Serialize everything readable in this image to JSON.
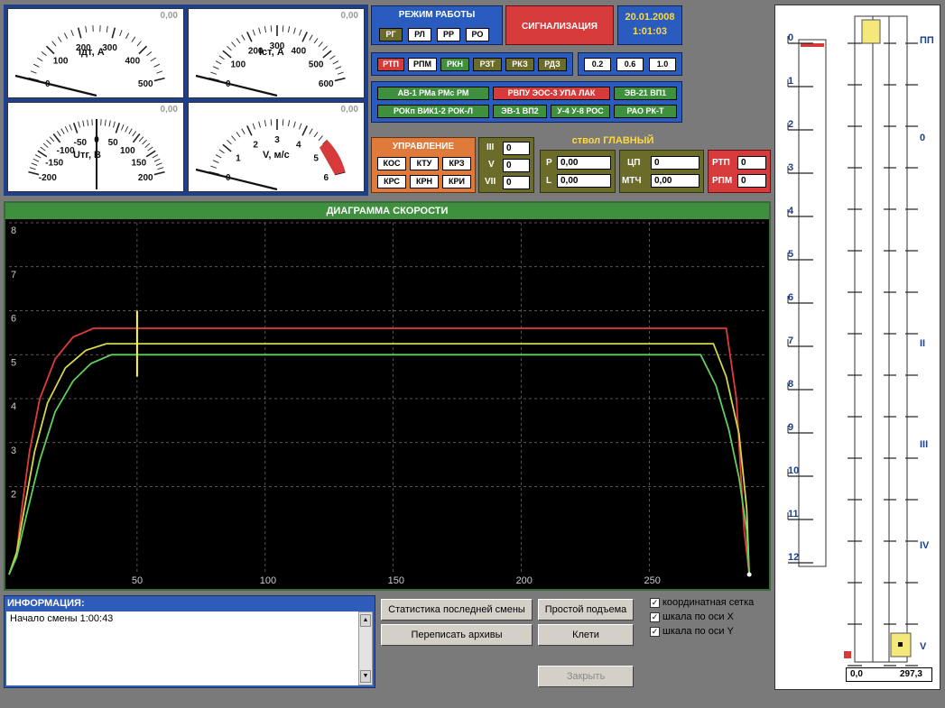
{
  "gauges": [
    {
      "id": "idt",
      "label": "Iдт, А",
      "value": "0,00",
      "ticks": [
        "0",
        "100",
        "200",
        "300",
        "400",
        "500"
      ]
    },
    {
      "id": "ist",
      "label": "Iст, А",
      "value": "0,00",
      "ticks": [
        "0",
        "100",
        "200",
        "300",
        "400",
        "500",
        "600"
      ]
    },
    {
      "id": "utg",
      "label": "Uтг, В",
      "value": "0,00",
      "ticks": [
        "-200",
        "-150",
        "-100",
        "-50",
        "0",
        "50",
        "100",
        "150",
        "200"
      ]
    },
    {
      "id": "v",
      "label": "V, м/с",
      "value": "0,00",
      "ticks": [
        "0",
        "1",
        "2",
        "3",
        "4",
        "5",
        "6"
      ]
    }
  ],
  "mode": {
    "title": "РЕЖИМ РАБОТЫ",
    "buttons": [
      "РГ",
      "РЛ",
      "РР",
      "РО"
    ]
  },
  "alarm": {
    "label": "СИГНАЛИЗАЦИЯ"
  },
  "datetime": {
    "date": "20.01.2008",
    "time": "1:01:03"
  },
  "relays": [
    "РТП",
    "РПМ",
    "РКН",
    "РЗТ",
    "РКЗ",
    "РДЗ"
  ],
  "steps": [
    "0.2",
    "0.6",
    "1.0"
  ],
  "protections": {
    "row1": [
      "АВ-1 РМа РМс РМ",
      "РВПУ ЭОС-3 УПА ЛАК",
      "ЭВ-21 ВП1"
    ],
    "row2": [
      "РОКп ВИК1-2 РОК-Л",
      "ЭВ-1 ВП2",
      "У-4 У-8 РОС",
      "РАО РК-Т"
    ]
  },
  "control": {
    "title": "УПРАВЛЕНИЕ",
    "row1": [
      "КОС",
      "КТУ",
      "КРЗ"
    ],
    "row2": [
      "КРС",
      "КРН",
      "КРИ"
    ]
  },
  "gears": [
    {
      "label": "III",
      "value": "0"
    },
    {
      "label": "V",
      "value": "0"
    },
    {
      "label": "VII",
      "value": "0"
    }
  ],
  "shaft_title": "ствол ГЛАВНЫЙ",
  "pl": [
    {
      "label": "P",
      "value": "0,00"
    },
    {
      "label": "L",
      "value": "0,00"
    }
  ],
  "cp": [
    {
      "label": "ЦП",
      "value": "0"
    },
    {
      "label": "МТЧ",
      "value": "0,00"
    }
  ],
  "rtp": [
    {
      "label": "РТП",
      "value": "0"
    },
    {
      "label": "РПМ",
      "value": "0"
    }
  ],
  "chart_data": {
    "type": "line",
    "title": "ДИАГРАММА СКОРОСТИ",
    "xlim": [
      0,
      296
    ],
    "ylim": [
      0,
      8
    ],
    "x_ticks": [
      50,
      100,
      150,
      200,
      250
    ],
    "y_ticks": [
      2,
      3,
      4,
      5,
      6,
      7,
      8
    ],
    "grid": true,
    "series": [
      {
        "color": "#e03b3b",
        "points": [
          [
            0,
            0
          ],
          [
            3,
            0.5
          ],
          [
            5,
            1.5
          ],
          [
            8,
            2.8
          ],
          [
            12,
            4.0
          ],
          [
            18,
            4.9
          ],
          [
            25,
            5.4
          ],
          [
            33,
            5.6
          ],
          [
            40,
            5.6
          ],
          [
            280,
            5.6
          ],
          [
            284,
            4.0
          ],
          [
            286,
            2.0
          ],
          [
            287,
            1.0
          ],
          [
            289,
            0
          ]
        ]
      },
      {
        "color": "#d6d64a",
        "points": [
          [
            0,
            0
          ],
          [
            3,
            0.5
          ],
          [
            6,
            1.5
          ],
          [
            10,
            2.8
          ],
          [
            15,
            3.9
          ],
          [
            22,
            4.7
          ],
          [
            30,
            5.1
          ],
          [
            38,
            5.25
          ],
          [
            45,
            5.25
          ],
          [
            275,
            5.25
          ],
          [
            280,
            4.5
          ],
          [
            285,
            3.2
          ],
          [
            288,
            1.5
          ],
          [
            289,
            0
          ]
        ]
      },
      {
        "color": "#5fcf5f",
        "points": [
          [
            0,
            0
          ],
          [
            3,
            0.4
          ],
          [
            7,
            1.4
          ],
          [
            12,
            2.6
          ],
          [
            18,
            3.7
          ],
          [
            25,
            4.4
          ],
          [
            32,
            4.8
          ],
          [
            40,
            5.0
          ],
          [
            48,
            5.0
          ],
          [
            270,
            5.0
          ],
          [
            276,
            4.3
          ],
          [
            281,
            3.3
          ],
          [
            285,
            2.2
          ],
          [
            288,
            1.0
          ],
          [
            289,
            0
          ]
        ]
      }
    ],
    "marker": {
      "x": 50,
      "y0": 4.5,
      "y1": 6.0,
      "color": "#ffff44"
    }
  },
  "info": {
    "title": "ИНФОРМАЦИЯ:",
    "text": "Начало смены 1:00:43"
  },
  "buttons": {
    "stats": "Статистика последней смены",
    "idle": "Простой подъема",
    "rewrite": "Переписать архивы",
    "cages": "Клети",
    "close": "Закрыть"
  },
  "checks": [
    "координатная сетка",
    "шкала по оси X",
    "шкала по оси Y"
  ],
  "shaft": {
    "left_scale": [
      "0",
      "1",
      "2",
      "3",
      "4",
      "5",
      "6",
      "7",
      "8",
      "9",
      "10",
      "11",
      "12"
    ],
    "right_scale": [
      "ПП",
      "0",
      "II",
      "III",
      "IV",
      "V"
    ],
    "from": "0,0",
    "to": "297,3"
  }
}
